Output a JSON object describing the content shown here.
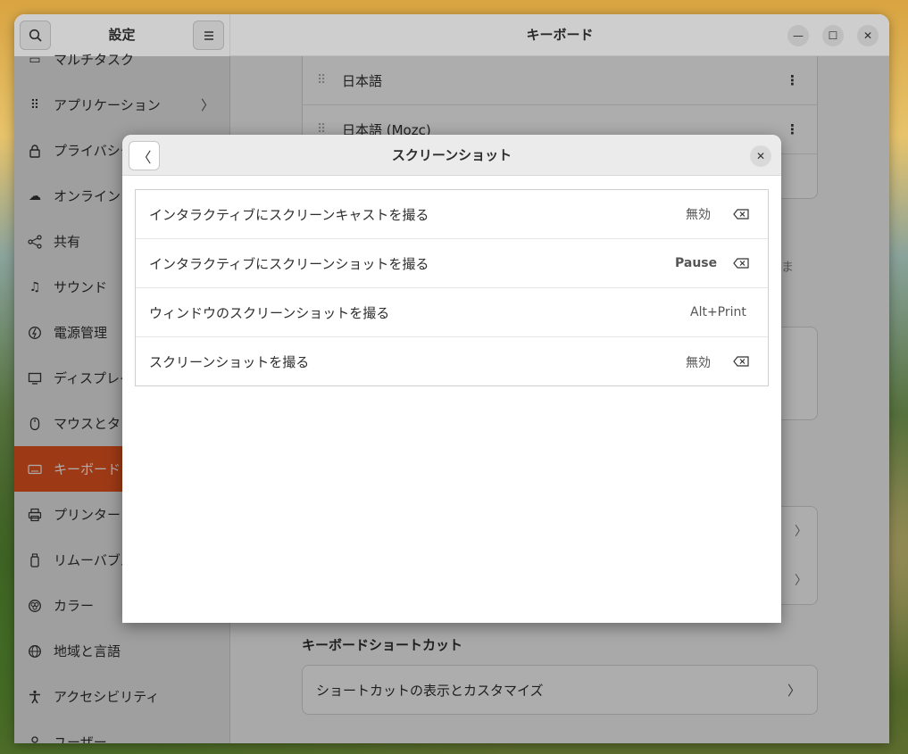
{
  "sidebar": {
    "title": "設定",
    "items": [
      {
        "label": "マルチタスク",
        "icon": "multitask-icon"
      },
      {
        "label": "アプリケーション",
        "icon": "grid-icon"
      },
      {
        "label": "プライバシー",
        "icon": "lock-icon"
      },
      {
        "label": "オンライン",
        "icon": "cloud-icon"
      },
      {
        "label": "共有",
        "icon": "share-icon"
      },
      {
        "label": "サウンド",
        "icon": "music-note-icon"
      },
      {
        "label": "電源管理",
        "icon": "power-icon"
      },
      {
        "label": "ディスプレイ",
        "icon": "display-icon"
      },
      {
        "label": "マウスとタ",
        "icon": "mouse-icon"
      },
      {
        "label": "キーボード",
        "icon": "keyboard-icon"
      },
      {
        "label": "プリンター",
        "icon": "printer-icon"
      },
      {
        "label": "リムーバブル",
        "icon": "removable-icon"
      },
      {
        "label": "カラー",
        "icon": "color-icon"
      },
      {
        "label": "地域と言語",
        "icon": "globe-icon"
      },
      {
        "label": "アクセシビリティ",
        "icon": "accessibility-icon"
      },
      {
        "label": "ユーザー",
        "icon": "user-icon"
      }
    ]
  },
  "main": {
    "title": "キーボード",
    "input_sources": [
      "日本語",
      "日本語 (Mozc)"
    ],
    "peek_text": "ま",
    "section_title": "キーボードショートカット",
    "shortcut_row": "ショートカットの表示とカスタマイズ"
  },
  "dialog": {
    "title": "スクリーンショット",
    "rows": [
      {
        "label": "インタラクティブにスクリーンキャストを撮る",
        "accel": "無効",
        "clearable": true,
        "bold": false
      },
      {
        "label": "インタラクティブにスクリーンショットを撮る",
        "accel": "Pause",
        "clearable": true,
        "bold": true
      },
      {
        "label": "ウィンドウのスクリーンショットを撮る",
        "accel": "Alt+Print",
        "clearable": false,
        "bold": false
      },
      {
        "label": "スクリーンショットを撮る",
        "accel": "無効",
        "clearable": true,
        "bold": false
      }
    ]
  },
  "colors": {
    "accent": "#e95420"
  }
}
